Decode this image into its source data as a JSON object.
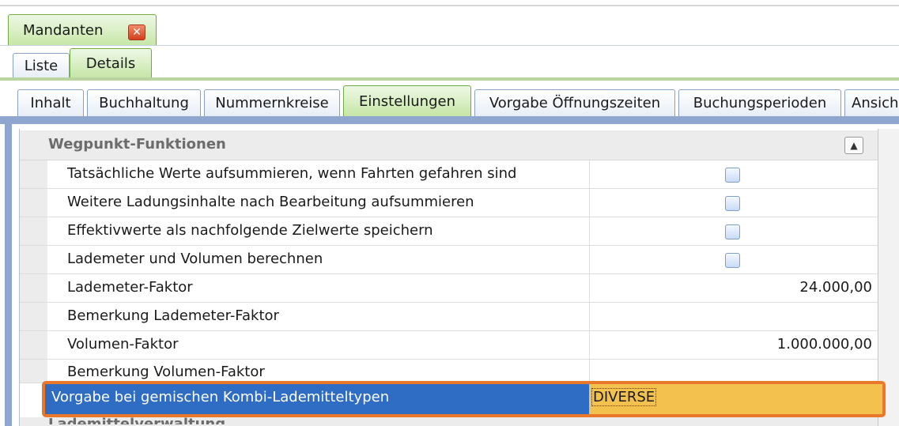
{
  "window": {
    "tab_title": "Mandanten",
    "close_icon": "close-icon"
  },
  "view_tabs": [
    {
      "label": "Liste",
      "active": false
    },
    {
      "label": "Details",
      "active": true
    }
  ],
  "section_tabs": [
    {
      "label": "Inhalt",
      "active": false
    },
    {
      "label": "Buchhaltung",
      "active": false
    },
    {
      "label": "Nummernkreise",
      "active": false
    },
    {
      "label": "Einstellungen",
      "active": true
    },
    {
      "label": "Vorgabe Öffnungszeiten",
      "active": false
    },
    {
      "label": "Buchungsperioden",
      "active": false
    },
    {
      "label": "Ansich",
      "active": false
    }
  ],
  "grid": {
    "category": "Wegpunkt-Funktionen",
    "collapse_icon": "chevron-up-icon",
    "rows": [
      {
        "label": "Tatsächliche Werte aufsummieren, wenn Fahrten gefahren sind",
        "type": "checkbox",
        "checked": false
      },
      {
        "label": "Weitere Ladungsinhalte nach Bearbeitung aufsummieren",
        "type": "checkbox",
        "checked": false
      },
      {
        "label": "Effektivwerte als nachfolgende Zielwerte speichern",
        "type": "checkbox",
        "checked": false
      },
      {
        "label": "Lademeter und Volumen berechnen",
        "type": "checkbox",
        "checked": false
      },
      {
        "label": "Lademeter-Faktor",
        "type": "number",
        "value": "24.000,00"
      },
      {
        "label": "Bemerkung Lademeter-Faktor",
        "type": "text",
        "value": ""
      },
      {
        "label": "Volumen-Faktor",
        "type": "number",
        "value": "1.000.000,00"
      },
      {
        "label": "Bemerkung Volumen-Faktor",
        "type": "text",
        "value": ""
      }
    ],
    "selected_row": {
      "label": "Vorgabe bei gemischen Kombi-Lademitteltypen",
      "value": "DIVERSE"
    },
    "next_category": "Lademittelverwaltung"
  },
  "colors": {
    "selection": "#2f6cc4",
    "selected_value": "#f2c14e",
    "highlight_border": "#e9782a",
    "active_tab": "#c6e6a6"
  }
}
